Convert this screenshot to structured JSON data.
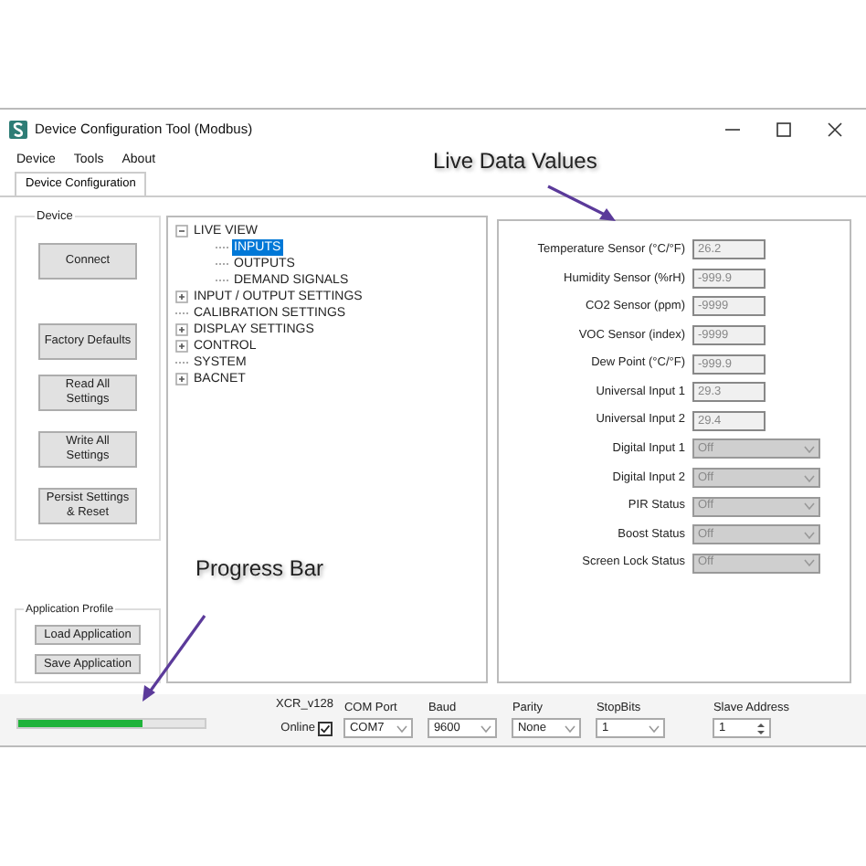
{
  "window": {
    "title": "Device Configuration Tool (Modbus)"
  },
  "menu": [
    "Device",
    "Tools",
    "About"
  ],
  "tabs": [
    {
      "label": "Device Configuration",
      "selected": true
    }
  ],
  "device_group": {
    "title": "Device",
    "buttons": [
      "Connect",
      "Factory Defaults",
      "Read All Settings",
      "Write All Settings",
      "Persist Settings & Reset"
    ]
  },
  "app_profile": {
    "title": "Application Profile",
    "buttons": [
      "Load Application",
      "Save Application"
    ]
  },
  "tree": [
    {
      "label": "LIVE VIEW",
      "kind": "branch",
      "expanded": true,
      "selected": false,
      "children": [
        {
          "label": "INPUTS",
          "selected": true
        },
        {
          "label": "OUTPUTS",
          "selected": false
        },
        {
          "label": "DEMAND SIGNALS",
          "selected": false
        }
      ]
    },
    {
      "label": "INPUT / OUTPUT SETTINGS",
      "kind": "branch",
      "expanded": false,
      "selected": false
    },
    {
      "label": "CALIBRATION SETTINGS",
      "kind": "leaf",
      "selected": false
    },
    {
      "label": "DISPLAY SETTINGS",
      "kind": "branch",
      "expanded": false,
      "selected": false
    },
    {
      "label": "CONTROL",
      "kind": "branch",
      "expanded": false,
      "selected": false
    },
    {
      "label": "SYSTEM",
      "kind": "leaf",
      "selected": false
    },
    {
      "label": "BACNET",
      "kind": "branch",
      "expanded": false,
      "selected": false
    }
  ],
  "fields": [
    {
      "kind": "text",
      "label": "Temperature Sensor (°C/°F)",
      "value": "26.2"
    },
    {
      "kind": "text",
      "label": "Humidity Sensor (%rH)",
      "value": "-999.9"
    },
    {
      "kind": "text",
      "label": "CO2 Sensor (ppm)",
      "value": "-9999"
    },
    {
      "kind": "text",
      "label": "VOC Sensor (index)",
      "value": "-9999"
    },
    {
      "kind": "text",
      "label": "Dew Point (°C/°F)",
      "value": "-999.9"
    },
    {
      "kind": "text",
      "label": "Universal Input 1",
      "value": "29.3"
    },
    {
      "kind": "text",
      "label": "Universal Input 2",
      "value": "29.4"
    },
    {
      "kind": "dropdown",
      "label": "Digital Input 1",
      "value": "Off"
    },
    {
      "kind": "dropdown",
      "label": "Digital Input 2",
      "value": "Off"
    },
    {
      "kind": "dropdown",
      "label": "PIR Status",
      "value": "Off"
    },
    {
      "kind": "dropdown",
      "label": "Boost Status",
      "value": "Off"
    },
    {
      "kind": "dropdown",
      "label": "Screen Lock Status",
      "value": "Off"
    }
  ],
  "status_bar": {
    "progress": {
      "level": 0.67
    },
    "version": "XCR_v128",
    "online": {
      "label": "Online",
      "checked": true
    },
    "settings": [
      {
        "kind": "dropdown",
        "label": "COM Port",
        "value": "COM7"
      },
      {
        "kind": "dropdown",
        "label": "Baud",
        "value": "9600"
      },
      {
        "kind": "dropdown",
        "label": "Parity",
        "value": "None"
      },
      {
        "kind": "dropdown",
        "label": "StopBits",
        "value": "1"
      },
      {
        "kind": "spinner",
        "label": "Slave Address",
        "value": "1"
      }
    ]
  },
  "annotations": [
    {
      "text": "Live Data Values"
    },
    {
      "text": "Progress Bar"
    }
  ]
}
